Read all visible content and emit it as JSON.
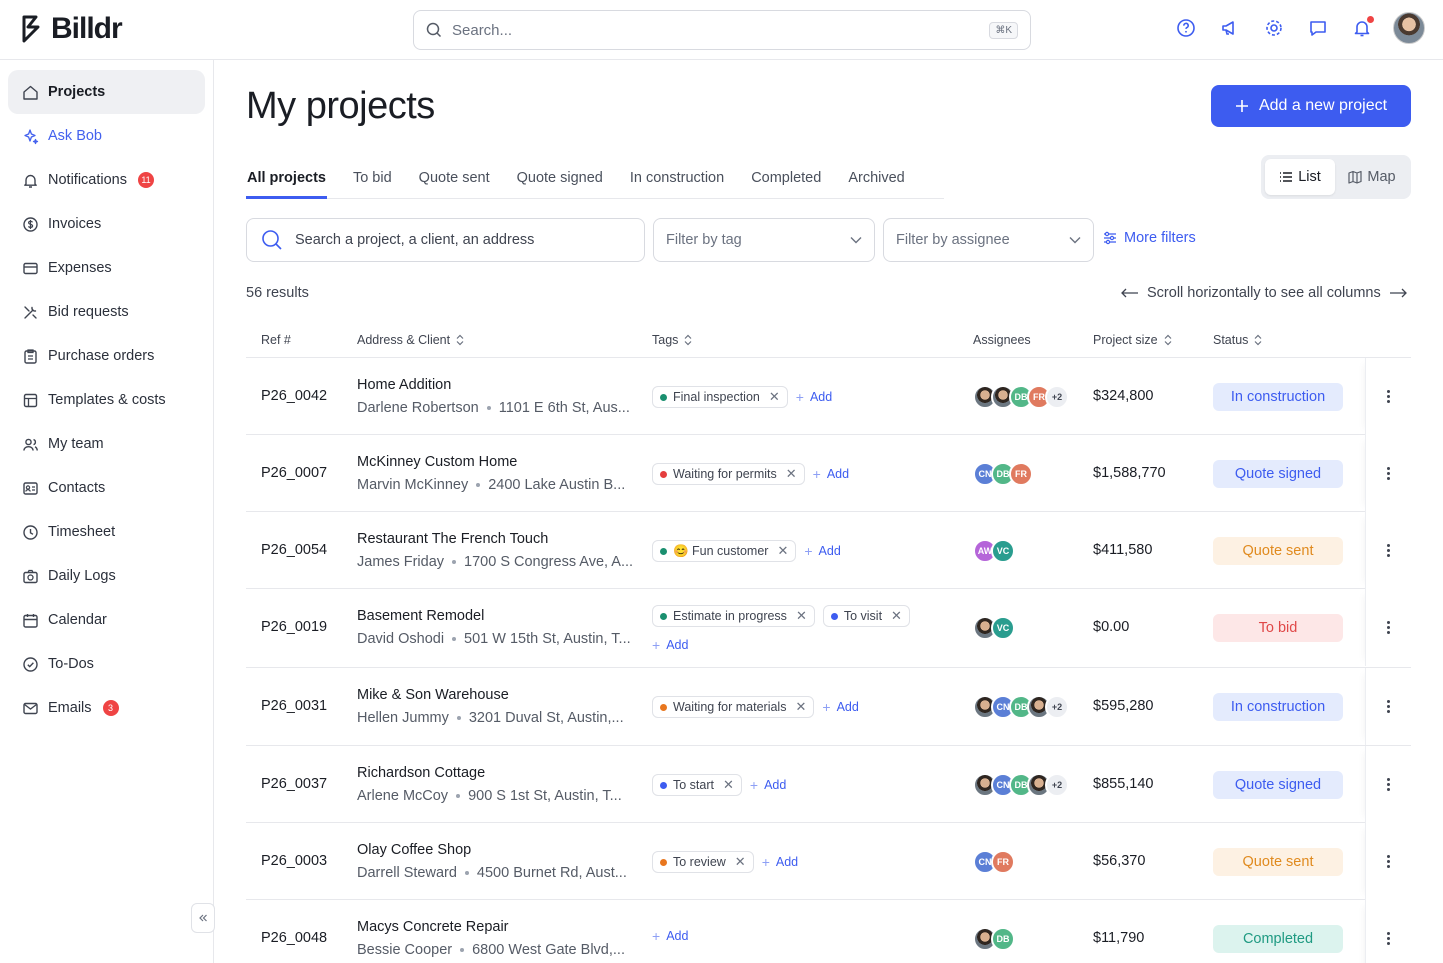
{
  "brand": {
    "name": "Billdr"
  },
  "search": {
    "placeholder": "Search...",
    "shortcut": "⌘K"
  },
  "header_icons": [
    "help-icon",
    "megaphone-icon",
    "gear-icon",
    "chat-icon",
    "bell-icon"
  ],
  "sidebar": {
    "items": [
      {
        "label": "Projects",
        "icon": "home-icon",
        "active": true
      },
      {
        "label": "Ask Bob",
        "icon": "sparkle-icon"
      },
      {
        "label": "Notifications",
        "icon": "bell-icon",
        "badge": "11"
      },
      {
        "label": "Invoices",
        "icon": "dollar-icon"
      },
      {
        "label": "Expenses",
        "icon": "card-icon"
      },
      {
        "label": "Bid requests",
        "icon": "tools-icon"
      },
      {
        "label": "Purchase orders",
        "icon": "clipboard-icon"
      },
      {
        "label": "Templates & costs",
        "icon": "template-icon"
      },
      {
        "label": "My team",
        "icon": "team-icon"
      },
      {
        "label": "Contacts",
        "icon": "contacts-icon"
      },
      {
        "label": "Timesheet",
        "icon": "clock-icon"
      },
      {
        "label": "Daily Logs",
        "icon": "camera-icon"
      },
      {
        "label": "Calendar",
        "icon": "calendar-icon"
      },
      {
        "label": "To-Dos",
        "icon": "check-circle-icon"
      },
      {
        "label": "Emails",
        "icon": "mail-icon",
        "badge": "3"
      }
    ]
  },
  "main": {
    "title": "My projects",
    "add_button": "Add a new project",
    "tabs": [
      "All projects",
      "To bid",
      "Quote sent",
      "Quote signed",
      "In construction",
      "Completed",
      "Archived"
    ],
    "view_toggle": {
      "list": "List",
      "map": "Map"
    },
    "filters": {
      "search_placeholder": "Search a project, a client, an address",
      "tag": "Filter by tag",
      "assignee": "Filter by assignee",
      "more": "More filters"
    },
    "results": "56 results",
    "scroll_hint": "Scroll horizontally to see all columns",
    "columns": {
      "ref": "Ref #",
      "address": "Address & Client",
      "tags": "Tags",
      "assignees": "Assignees",
      "size": "Project size",
      "status": "Status"
    },
    "add_tag_label": "Add"
  },
  "status_colors": {
    "In construction": {
      "bg": "#e4ebfd",
      "fg": "#3d5cf0"
    },
    "Quote signed": {
      "bg": "#e4ebfd",
      "fg": "#3d5cf0"
    },
    "Quote sent": {
      "bg": "#fdf1e3",
      "fg": "#e08a1e"
    },
    "To bid": {
      "bg": "#fde7e7",
      "fg": "#e04848"
    },
    "Completed": {
      "bg": "#dcf3ee",
      "fg": "#1f9a82"
    }
  },
  "rows": [
    {
      "ref": "P26_0042",
      "name": "Home Addition",
      "client": "Darlene Robertson",
      "address": "1101 E 6th St, Aus...",
      "tags": [
        {
          "label": "Final inspection",
          "color": "#1a8f6f"
        }
      ],
      "assignees": [
        "photo",
        "photo",
        "DB",
        "FR"
      ],
      "more": "+2",
      "size": "$324,800",
      "status": "In construction"
    },
    {
      "ref": "P26_0007",
      "name": "McKinney Custom Home",
      "client": "Marvin McKinney",
      "address": "2400 Lake Austin B...",
      "tags": [
        {
          "label": "Waiting for permits",
          "color": "#e53e3e"
        }
      ],
      "assignees": [
        "CN",
        "DB",
        "FR"
      ],
      "more": "",
      "size": "$1,588,770",
      "status": "Quote signed"
    },
    {
      "ref": "P26_0054",
      "name": "Restaurant The French Touch",
      "client": "James Friday",
      "address": "1700 S Congress Ave, A...",
      "tags": [
        {
          "label": "😊 Fun customer",
          "color": "#1a8f6f"
        }
      ],
      "assignees": [
        "AW",
        "VC"
      ],
      "more": "",
      "size": "$411,580",
      "status": "Quote sent"
    },
    {
      "ref": "P26_0019",
      "name": "Basement Remodel",
      "client": "David Oshodi",
      "address": "501 W 15th St, Austin, T...",
      "tags": [
        {
          "label": "Estimate in progress",
          "color": "#1a8f6f"
        },
        {
          "label": "To visit",
          "color": "#3d5cf0"
        }
      ],
      "assignees": [
        "photo",
        "VC"
      ],
      "more": "",
      "size": "$0.00",
      "status": "To bid"
    },
    {
      "ref": "P26_0031",
      "name": "Mike & Son Warehouse",
      "client": "Hellen Jummy",
      "address": "3201 Duval St, Austin,...",
      "tags": [
        {
          "label": "Waiting for materials",
          "color": "#e8761e"
        }
      ],
      "assignees": [
        "photo",
        "CN",
        "DB",
        "photo"
      ],
      "more": "+2",
      "size": "$595,280",
      "status": "In construction"
    },
    {
      "ref": "P26_0037",
      "name": "Richardson Cottage",
      "client": "Arlene McCoy",
      "address": "900 S 1st St, Austin, T...",
      "tags": [
        {
          "label": "To start",
          "color": "#3d5cf0"
        }
      ],
      "assignees": [
        "photo",
        "CN",
        "DB",
        "photo"
      ],
      "more": "+2",
      "size": "$855,140",
      "status": "Quote signed"
    },
    {
      "ref": "P26_0003",
      "name": "Olay Coffee Shop",
      "client": "Darrell Steward",
      "address": "4500 Burnet Rd, Aust...",
      "tags": [
        {
          "label": "To review",
          "color": "#e8761e"
        }
      ],
      "assignees": [
        "CN",
        "FR"
      ],
      "more": "",
      "size": "$56,370",
      "status": "Quote sent"
    },
    {
      "ref": "P26_0048",
      "name": "Macys Concrete Repair",
      "client": "Bessie Cooper",
      "address": "6800 West Gate Blvd,...",
      "tags": [],
      "assignees": [
        "photo",
        "DB"
      ],
      "more": "",
      "size": "$11,790",
      "status": "Completed"
    }
  ],
  "avatar_colors": {
    "DB": "#52b788",
    "FR": "#e07a5f",
    "CN": "#5b7fd6",
    "VC": "#2a9d8f",
    "AW": "#b565d9"
  }
}
